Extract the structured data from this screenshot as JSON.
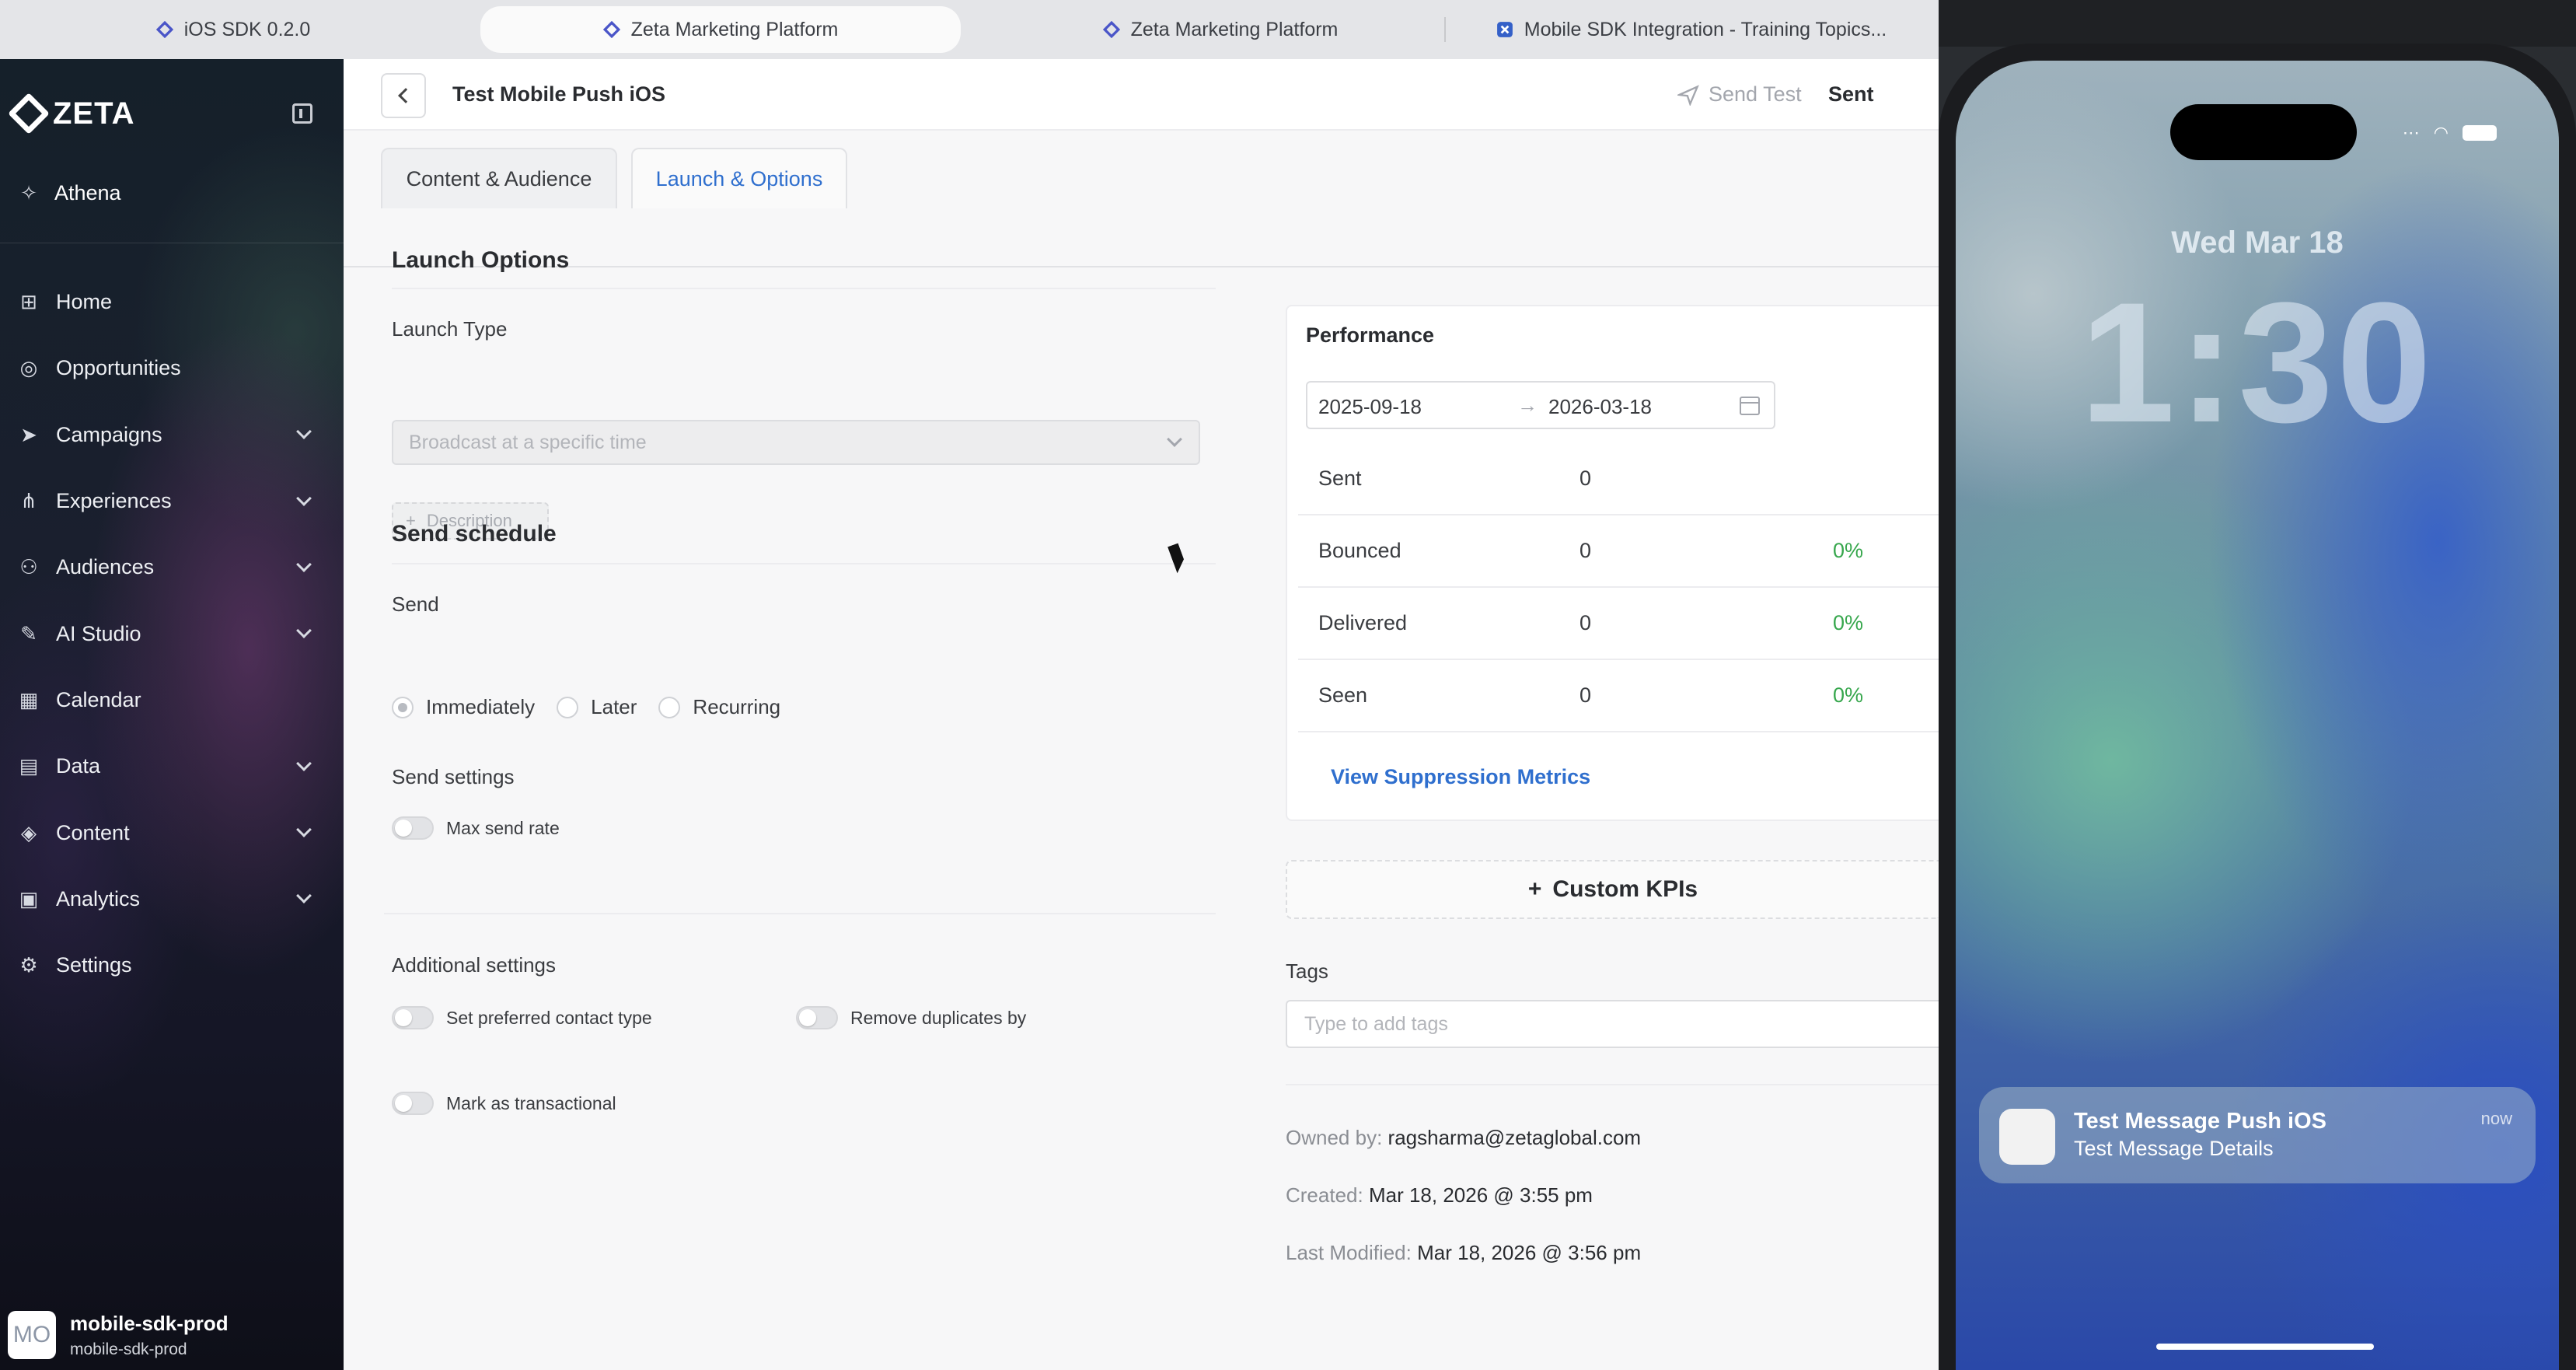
{
  "browser": {
    "tabs": [
      {
        "label": "iOS SDK 0.2.0",
        "icon": "zeta-diamond-icon"
      },
      {
        "label": "Zeta Marketing Platform",
        "icon": "zeta-diamond-icon"
      },
      {
        "label": "Zeta Marketing Platform",
        "icon": "zeta-diamond-icon"
      },
      {
        "label": "Mobile SDK Integration - Training Topics...",
        "icon": "app-x-icon"
      }
    ]
  },
  "sidebar": {
    "logo": "ZETA",
    "athena": "Athena",
    "items": [
      {
        "label": "Home",
        "icon": "grid-icon",
        "expandable": false
      },
      {
        "label": "Opportunities",
        "icon": "target-icon",
        "expandable": false
      },
      {
        "label": "Campaigns",
        "icon": "send-icon",
        "expandable": true
      },
      {
        "label": "Experiences",
        "icon": "flow-icon",
        "expandable": true
      },
      {
        "label": "Audiences",
        "icon": "people-icon",
        "expandable": true
      },
      {
        "label": "AI Studio",
        "icon": "ai-icon",
        "expandable": true
      },
      {
        "label": "Calendar",
        "icon": "calendar-icon",
        "expandable": false
      },
      {
        "label": "Data",
        "icon": "database-icon",
        "expandable": true
      },
      {
        "label": "Content",
        "icon": "content-icon",
        "expandable": true
      },
      {
        "label": "Analytics",
        "icon": "report-icon",
        "expandable": true
      },
      {
        "label": "Settings",
        "icon": "gear-icon",
        "expandable": false
      }
    ],
    "account": {
      "initials": "MO",
      "name": "mobile-sdk-prod",
      "sub": "mobile-sdk-prod"
    }
  },
  "header": {
    "title": "Test Mobile Push iOS",
    "send_test": "Send Test",
    "status": "Sent"
  },
  "tabs": [
    "Content & Audience",
    "Launch & Options"
  ],
  "launch": {
    "title": "Launch Options",
    "launch_type_label": "Launch Type",
    "launch_type_value": "Broadcast at a specific time",
    "description_btn": "Description",
    "schedule_title": "Send schedule",
    "send_label": "Send",
    "send_options": [
      "Immediately",
      "Later",
      "Recurring"
    ],
    "send_selected": "Immediately",
    "send_settings_label": "Send settings",
    "max_send_rate": "Max send rate",
    "additional_label": "Additional settings",
    "preferred_contact": "Set preferred contact type",
    "remove_duplicates": "Remove duplicates by",
    "transactional": "Mark as transactional"
  },
  "performance": {
    "title": "Performance",
    "date_from": "2025-09-18",
    "date_to": "2026-03-18",
    "arrow": "→",
    "metrics": [
      {
        "label": "Sent",
        "value": "0",
        "pct": ""
      },
      {
        "label": "Bounced",
        "value": "0",
        "pct": "0%"
      },
      {
        "label": "Delivered",
        "value": "0",
        "pct": "0%"
      },
      {
        "label": "Seen",
        "value": "0",
        "pct": "0%"
      }
    ],
    "suppression_link": "View Suppression Metrics",
    "custom_kpis": "Custom KPIs",
    "tags_label": "Tags",
    "tags_placeholder": "Type to add tags",
    "owned_by_label": "Owned by:",
    "owned_by": "ragsharma@zetaglobal.com",
    "created_label": "Created:",
    "created": "Mar 18, 2026 @ 3:55 pm",
    "modified_label": "Last Modified:",
    "modified": "Mar 18, 2026 @ 3:56 pm"
  },
  "phone": {
    "date": "Wed Mar 18",
    "time": "1:30",
    "notification": {
      "title": "Test Message Push iOS",
      "body": "Test Message Details",
      "time": "now"
    }
  },
  "colors": {
    "accent": "#2f6fce",
    "success": "#37a74d",
    "sidebar": "#151a26"
  }
}
